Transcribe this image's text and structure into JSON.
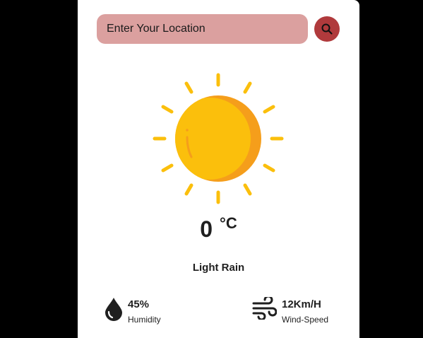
{
  "search": {
    "placeholder": "Enter Your Location",
    "button_icon": "search-icon"
  },
  "weather": {
    "icon": "sun-icon",
    "temperature": "0",
    "unit": "°C",
    "condition": "Light Rain"
  },
  "details": {
    "humidity": {
      "icon": "water-drop-icon",
      "value": "45%",
      "label": "Humidity"
    },
    "wind": {
      "icon": "wind-icon",
      "value": "12Km/H",
      "label": "Wind-Speed"
    }
  },
  "colors": {
    "page_background": "#000000",
    "card_background": "#ffffff",
    "search_field": "#dba09f",
    "search_button": "#b03a3c",
    "sun_primary": "#fbbf0c",
    "sun_shade": "#f59e1b",
    "text": "#1f1f1f"
  }
}
